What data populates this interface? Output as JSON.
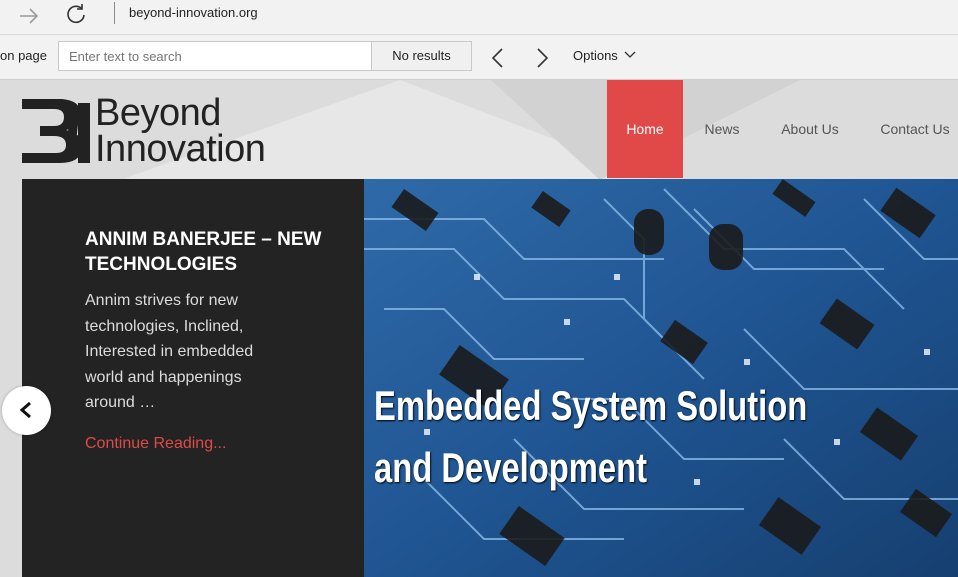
{
  "browser": {
    "url": "beyond-innovation.org"
  },
  "find_bar": {
    "label": "on page",
    "placeholder": "Enter text to search",
    "results": "No results",
    "options_label": "Options"
  },
  "site": {
    "logo": {
      "line1": "Beyond",
      "line2": "Innovation"
    },
    "menu": [
      {
        "label": "Home",
        "active": true
      },
      {
        "label": "News",
        "active": false
      },
      {
        "label": "About Us",
        "active": false
      },
      {
        "label": "Contact Us",
        "active": false
      }
    ],
    "slide": {
      "title": "ANNIM BANERJEE – NEW TECHNOLOGIES",
      "excerpt": "Annim strives for new technologies, Inclined, Interested in embedded world and happenings around …",
      "read_more": "Continue Reading...",
      "caption_line1": "Embedded System Solution",
      "caption_line2": "and Development"
    },
    "colors": {
      "accent": "#e14949",
      "panel": "#232323"
    }
  }
}
